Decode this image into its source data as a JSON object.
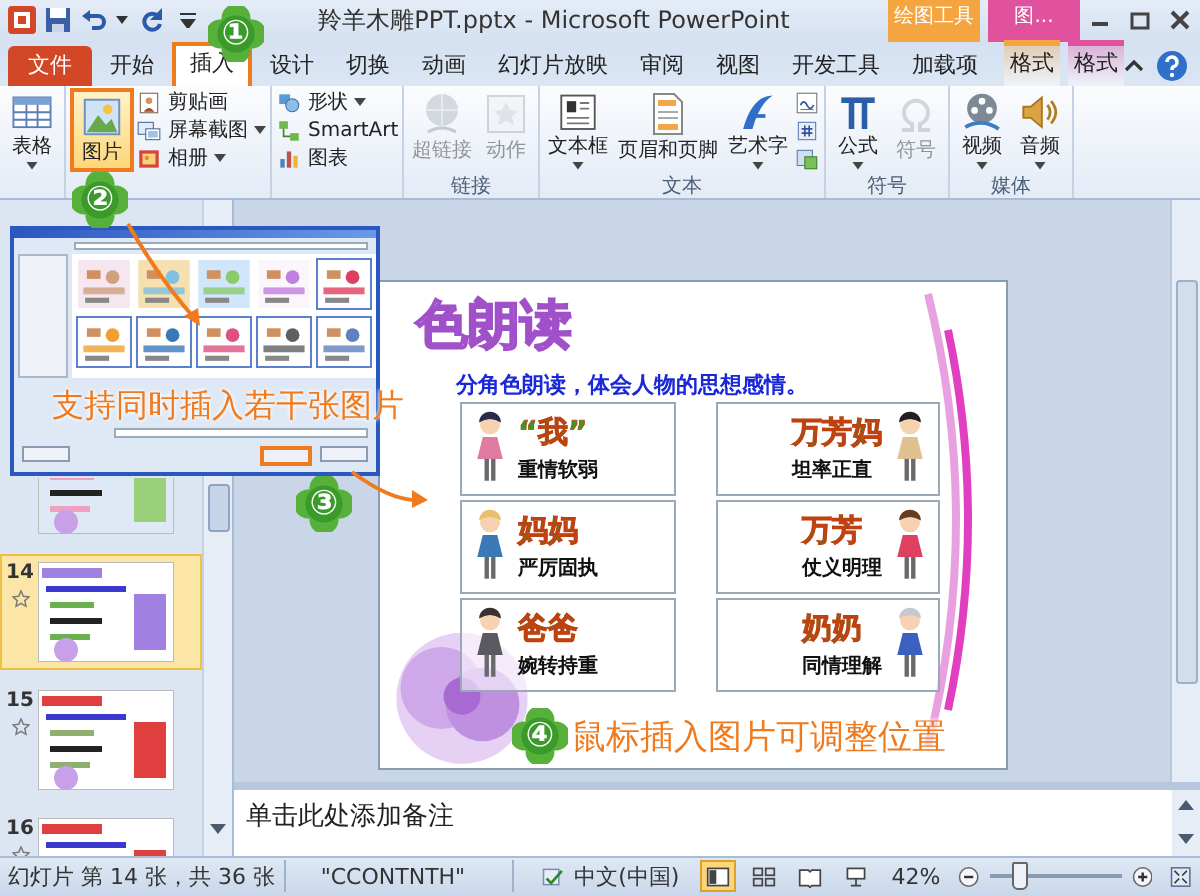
{
  "window": {
    "title": "羚羊木雕PPT.pptx  -  Microsoft PowerPoint"
  },
  "context_tabs": [
    {
      "label": "绘图工具",
      "color": "#f4a53f"
    },
    {
      "label": "图...",
      "color": "#e0529e"
    }
  ],
  "tabs": [
    {
      "label": "文件",
      "kind": "file",
      "selected": false
    },
    {
      "label": "开始",
      "kind": "main",
      "selected": false
    },
    {
      "label": "插入",
      "kind": "main",
      "selected": true
    },
    {
      "label": "设计",
      "kind": "main",
      "selected": false
    },
    {
      "label": "切换",
      "kind": "main",
      "selected": false
    },
    {
      "label": "动画",
      "kind": "main",
      "selected": false
    },
    {
      "label": "幻灯片放映",
      "kind": "main",
      "selected": false
    },
    {
      "label": "审阅",
      "kind": "main",
      "selected": false
    },
    {
      "label": "视图",
      "kind": "main",
      "selected": false
    },
    {
      "label": "开发工具",
      "kind": "main",
      "selected": false
    },
    {
      "label": "加载项",
      "kind": "main",
      "selected": false
    },
    {
      "label": "格式",
      "kind": "context",
      "color": "#f4a53f",
      "selected": false
    },
    {
      "label": "格式",
      "kind": "context",
      "color": "#e0529e",
      "selected": false
    }
  ],
  "ribbon": {
    "groups": [
      {
        "buttons": [
          {
            "label": "表格",
            "kind": "large",
            "dropdown": true,
            "disabled": false,
            "highlighted": false
          }
        ]
      },
      {
        "buttons": [
          {
            "label": "图片",
            "kind": "large",
            "dropdown": false,
            "disabled": false,
            "highlighted": true
          },
          {
            "label": "剪贴画",
            "kind": "small",
            "dropdown": false,
            "disabled": false,
            "highlighted": false
          },
          {
            "label": "屏幕截图",
            "kind": "small",
            "dropdown": true,
            "disabled": false,
            "highlighted": false
          },
          {
            "label": "相册",
            "kind": "small",
            "dropdown": true,
            "disabled": false,
            "highlighted": false
          }
        ]
      },
      {
        "buttons": [
          {
            "label": "形状",
            "kind": "small",
            "dropdown": true,
            "disabled": false,
            "highlighted": false
          },
          {
            "label": "SmartArt",
            "kind": "small",
            "dropdown": false,
            "disabled": false,
            "highlighted": false
          },
          {
            "label": "图表",
            "kind": "small",
            "dropdown": false,
            "disabled": false,
            "highlighted": false
          }
        ]
      },
      {
        "label": "链接",
        "buttons": [
          {
            "label": "超链接",
            "kind": "large",
            "dropdown": false,
            "disabled": true,
            "highlighted": false
          },
          {
            "label": "动作",
            "kind": "large",
            "dropdown": false,
            "disabled": true,
            "highlighted": false
          }
        ]
      },
      {
        "label": "文本",
        "buttons": [
          {
            "label": "文本框",
            "kind": "large",
            "dropdown": true,
            "disabled": false,
            "highlighted": false
          },
          {
            "label": "页眉和页脚",
            "kind": "large",
            "dropdown": false,
            "disabled": false,
            "highlighted": false
          },
          {
            "label": "艺术字",
            "kind": "large",
            "dropdown": true,
            "disabled": false,
            "highlighted": false
          },
          {
            "kind": "icon",
            "dropdown": false,
            "disabled": false,
            "highlighted": false
          },
          {
            "kind": "icon",
            "dropdown": false,
            "disabled": false,
            "highlighted": false
          },
          {
            "kind": "icon",
            "dropdown": false,
            "disabled": false,
            "highlighted": false
          }
        ]
      },
      {
        "label": "符号",
        "buttons": [
          {
            "label": "公式",
            "kind": "large",
            "dropdown": true,
            "disabled": false,
            "highlighted": false
          },
          {
            "label": "符号",
            "kind": "large",
            "dropdown": false,
            "disabled": true,
            "highlighted": false
          }
        ]
      },
      {
        "label": "媒体",
        "buttons": [
          {
            "label": "视频",
            "kind": "large",
            "dropdown": true,
            "disabled": false,
            "highlighted": false
          },
          {
            "label": "音频",
            "kind": "large",
            "dropdown": true,
            "disabled": false,
            "highlighted": false
          }
        ]
      }
    ]
  },
  "slides": [
    {
      "selected": false
    },
    {
      "number": "14",
      "selected": true
    },
    {
      "number": "15",
      "selected": false
    },
    {
      "number": "16",
      "selected": false
    }
  ],
  "slide": {
    "title": "色朗读",
    "subtitle": "分角色朗读，体会人物的思想感情。",
    "characters": [
      {
        "name": "“我”",
        "trait": "重情软弱"
      },
      {
        "name": "万芳妈",
        "trait": "坦率正直"
      },
      {
        "name": "妈妈",
        "trait": "严厉固执"
      },
      {
        "name": "万芳",
        "trait": "仗义明理"
      },
      {
        "name": "爸爸",
        "trait": "婉转持重"
      },
      {
        "name": "奶奶",
        "trait": "同情理解"
      }
    ]
  },
  "dialog": {
    "caption": "支持同时插入若干张图片"
  },
  "steps": [
    {
      "mark": "①"
    },
    {
      "mark": "②"
    },
    {
      "mark": "③"
    },
    {
      "mark": "④",
      "caption": "鼠标插入图片可调整位置"
    }
  ],
  "notes": {
    "placeholder": "单击此处添加备注"
  },
  "status_bar": {
    "slide_info": "幻灯片 第 14 张，共 36 张",
    "theme": "\"CCONTNTH\"",
    "language": "中文(中国)",
    "views": [
      {
        "selected": true
      },
      {
        "selected": false
      },
      {
        "selected": false
      },
      {
        "selected": false
      }
    ],
    "zoom": "42%",
    "level": 0.22
  }
}
